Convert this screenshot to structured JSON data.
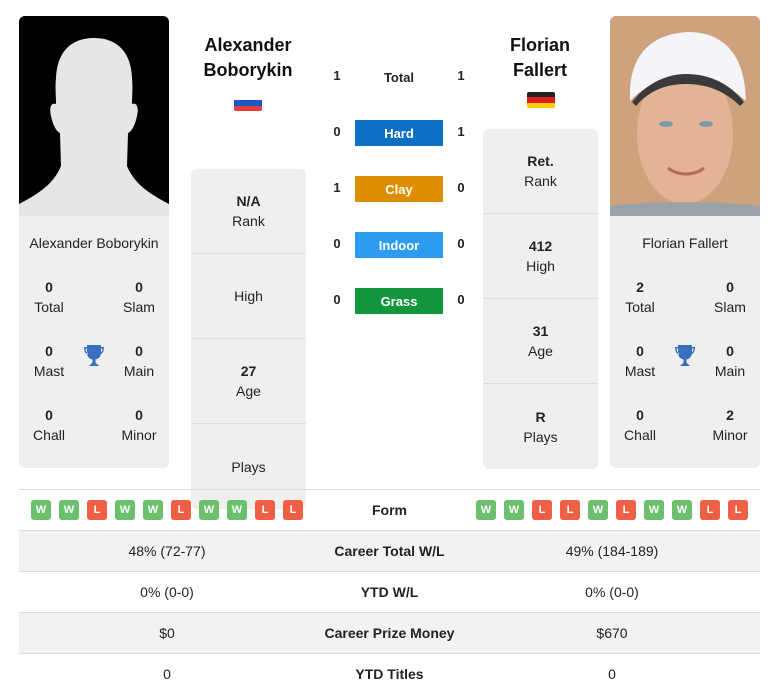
{
  "player1": {
    "name_line1": "Alexander",
    "name_line2": "Boborykin",
    "card_name": "Alexander Boborykin",
    "country": "Russia",
    "flag_colors": [
      "#ffffff",
      "#1c57c6",
      "#e53e3e"
    ],
    "photo": "silhouette-placeholder",
    "titles": {
      "total": {
        "value": "0",
        "label": "Total"
      },
      "slam": {
        "value": "0",
        "label": "Slam"
      },
      "mast": {
        "value": "0",
        "label": "Mast"
      },
      "main": {
        "value": "0",
        "label": "Main"
      },
      "chall": {
        "value": "0",
        "label": "Chall"
      },
      "minor": {
        "value": "0",
        "label": "Minor"
      }
    },
    "info": {
      "rank": {
        "value": "N/A",
        "label": "Rank"
      },
      "high": {
        "value": "",
        "label": "High"
      },
      "age": {
        "value": "27",
        "label": "Age"
      },
      "plays": {
        "value": "",
        "label": "Plays"
      }
    },
    "form": [
      "W",
      "W",
      "L",
      "W",
      "W",
      "L",
      "W",
      "W",
      "L",
      "L"
    ],
    "career_total_wl": "48% (72-77)",
    "ytd_wl": "0% (0-0)",
    "career_prize_money": "$0",
    "ytd_titles": "0"
  },
  "player2": {
    "name_line1": "Florian",
    "name_line2": "Fallert",
    "card_name": "Florian Fallert",
    "country": "Germany",
    "flag_colors": [
      "#222222",
      "#dd1f1f",
      "#ffcc00"
    ],
    "photo": "player-headshot",
    "titles": {
      "total": {
        "value": "2",
        "label": "Total"
      },
      "slam": {
        "value": "0",
        "label": "Slam"
      },
      "mast": {
        "value": "0",
        "label": "Mast"
      },
      "main": {
        "value": "0",
        "label": "Main"
      },
      "chall": {
        "value": "0",
        "label": "Chall"
      },
      "minor": {
        "value": "2",
        "label": "Minor"
      }
    },
    "info": {
      "rank": {
        "value": "Ret.",
        "label": "Rank"
      },
      "high": {
        "value": "412",
        "label": "High"
      },
      "age": {
        "value": "31",
        "label": "Age"
      },
      "plays": {
        "value": "R",
        "label": "Plays"
      }
    },
    "form": [
      "W",
      "W",
      "L",
      "L",
      "W",
      "L",
      "W",
      "W",
      "L",
      "L"
    ],
    "career_total_wl": "49% (184-189)",
    "ytd_wl": "0% (0-0)",
    "career_prize_money": "$670",
    "ytd_titles": "0"
  },
  "h2h": {
    "total": {
      "label": "Total",
      "p1": "1",
      "p2": "1"
    },
    "surfaces": [
      {
        "label": "Hard",
        "p1": "0",
        "p2": "1",
        "color": "#0b6fc4"
      },
      {
        "label": "Clay",
        "p1": "1",
        "p2": "0",
        "color": "#dd8f00"
      },
      {
        "label": "Indoor",
        "p1": "0",
        "p2": "0",
        "color": "#2d9cf0"
      },
      {
        "label": "Grass",
        "p1": "0",
        "p2": "0",
        "color": "#12963c"
      }
    ]
  },
  "table": {
    "form_label": "Form",
    "career_total_label": "Career Total W/L",
    "ytd_wl_label": "YTD W/L",
    "prize_label": "Career Prize Money",
    "ytd_titles_label": "YTD Titles"
  },
  "trophy_color": "#3a6fbf"
}
